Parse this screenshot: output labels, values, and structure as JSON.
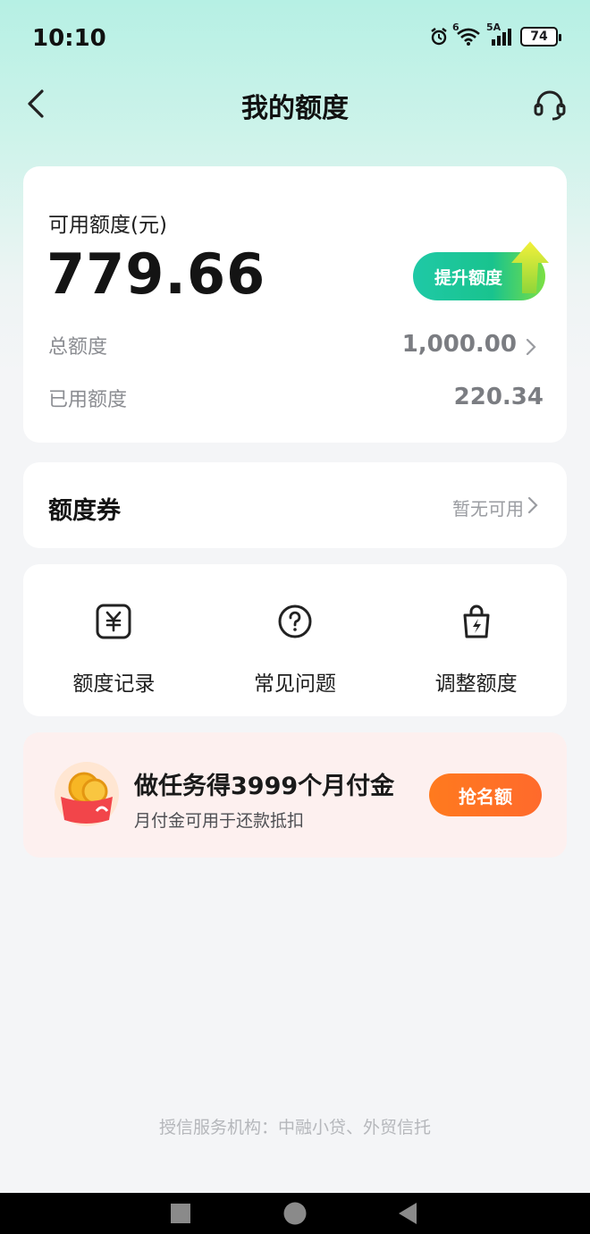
{
  "status_bar": {
    "time": "10:10",
    "battery": "74",
    "net_label": "5A",
    "wifi_label": "6"
  },
  "nav": {
    "title": "我的额度"
  },
  "quota": {
    "available_label": "可用额度(元)",
    "available_value": "779.66",
    "raise_button": "提升额度",
    "total_label": "总额度",
    "total_value": "1,000.00",
    "used_label": "已用额度",
    "used_value": "220.34"
  },
  "coupon": {
    "title": "额度券",
    "status": "暂无可用"
  },
  "actions": [
    {
      "label": "额度记录",
      "icon": "yuan-record-icon"
    },
    {
      "label": "常见问题",
      "icon": "question-icon"
    },
    {
      "label": "调整额度",
      "icon": "bag-bolt-icon"
    }
  ],
  "promo": {
    "title": "做任务得3999个月付金",
    "subtitle": "月付金可用于还款抵扣",
    "button": "抢名额"
  },
  "footer": {
    "note": "授信服务机构：中融小贷、外贸信托"
  },
  "colors": {
    "accent_green": "#19c38e",
    "promo_orange": "#ff6f26",
    "promo_bg": "#fdf0ef"
  }
}
